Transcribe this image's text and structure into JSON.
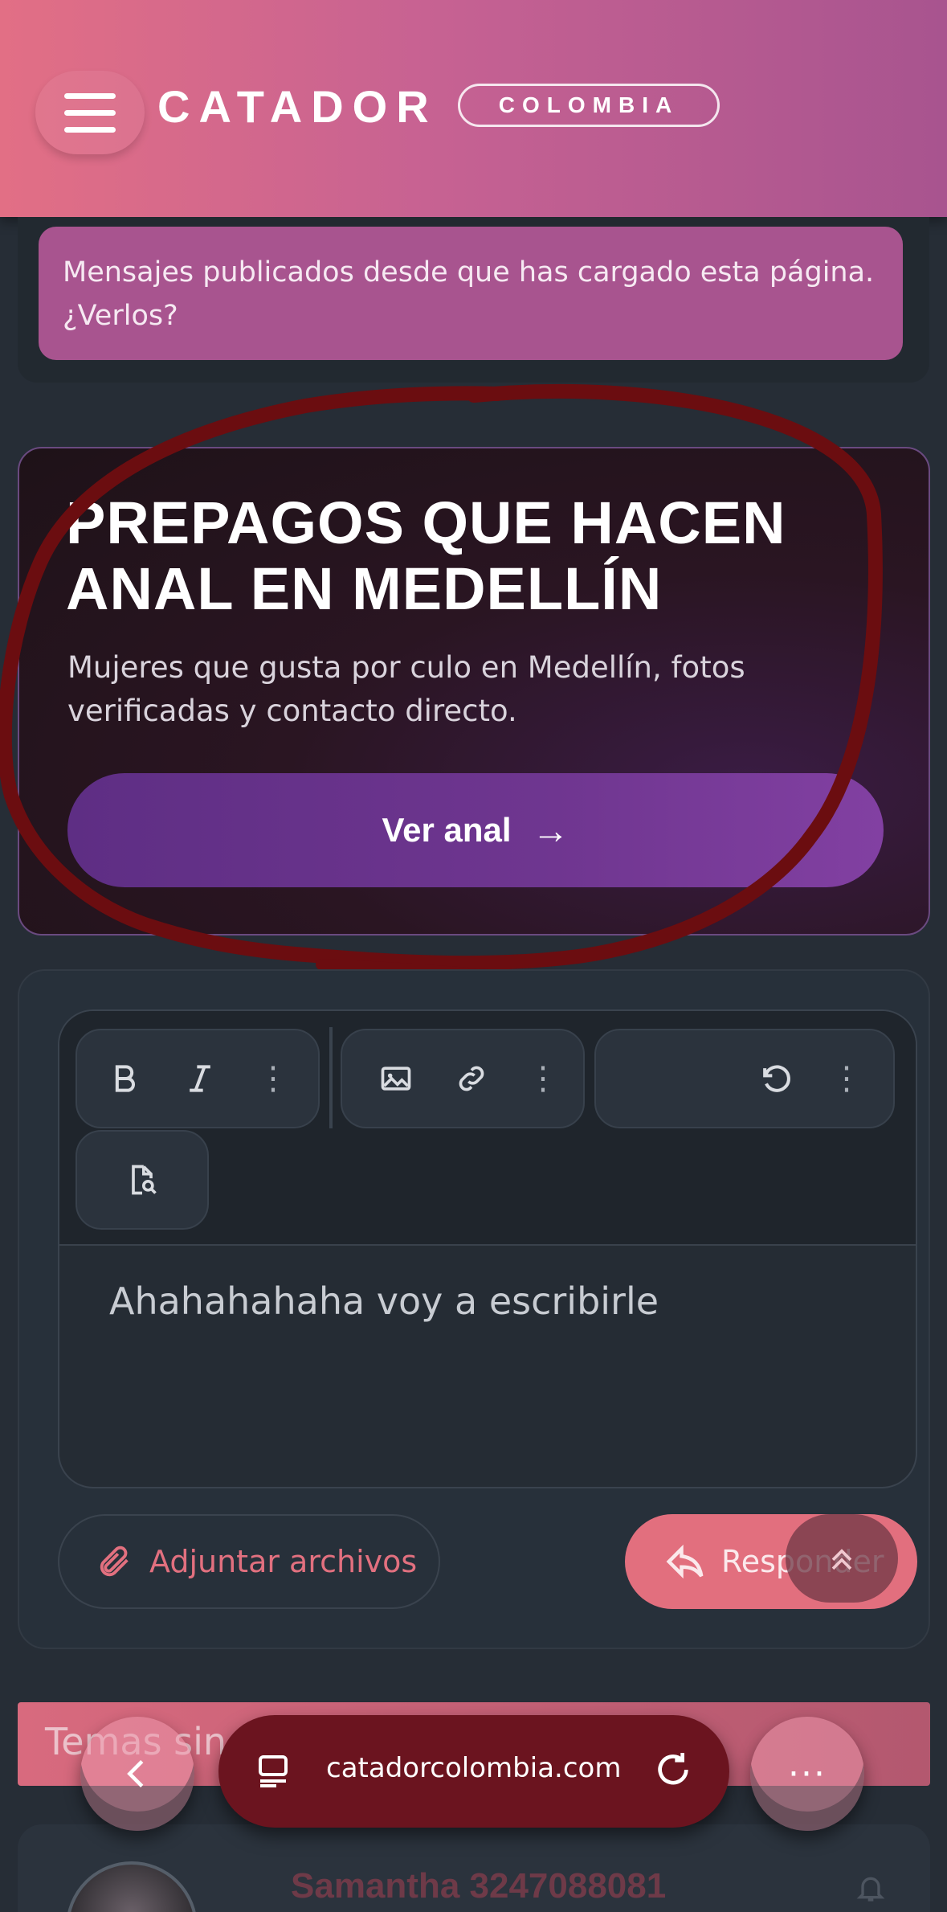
{
  "header": {
    "brand": "CATADOR",
    "badge": "COLOMBIA"
  },
  "notice": {
    "text": "Mensajes publicados desde que has cargado esta página. ¿Verlos?"
  },
  "promo": {
    "title_line1": "PREPAGOS QUE HACEN",
    "title_line2": "ANAL EN MEDELLÍN",
    "subtitle_line1": "Mujeres que gusta por culo en Medellín, fotos",
    "subtitle_line2": "verificadas y contacto directo.",
    "button_label": "Ver anal",
    "button_arrow": "→"
  },
  "editor": {
    "toolbar_icons": [
      "bold-icon",
      "italic-icon",
      "more-icon",
      "image-icon",
      "link-icon",
      "more-icon",
      "undo-icon",
      "more-icon",
      "preview-icon"
    ],
    "content": "Ahahahahaha voy a escribirle",
    "attach_label": "Adjuntar archivos",
    "reply_label": "Responder"
  },
  "list": {
    "section_label": "Temas sin...",
    "poster_name": "Samantha 3247088081"
  },
  "browser": {
    "url": "catadorcolombia.com",
    "more_label": "···"
  },
  "colors": {
    "header_start": "#e26f85",
    "header_end": "#a8548f",
    "notice_bg": "#a8548f",
    "promo_button": "#6f3690",
    "reply_button": "#e26f7e",
    "attach_accent": "#e2707f",
    "page_bg": "#262d36"
  }
}
